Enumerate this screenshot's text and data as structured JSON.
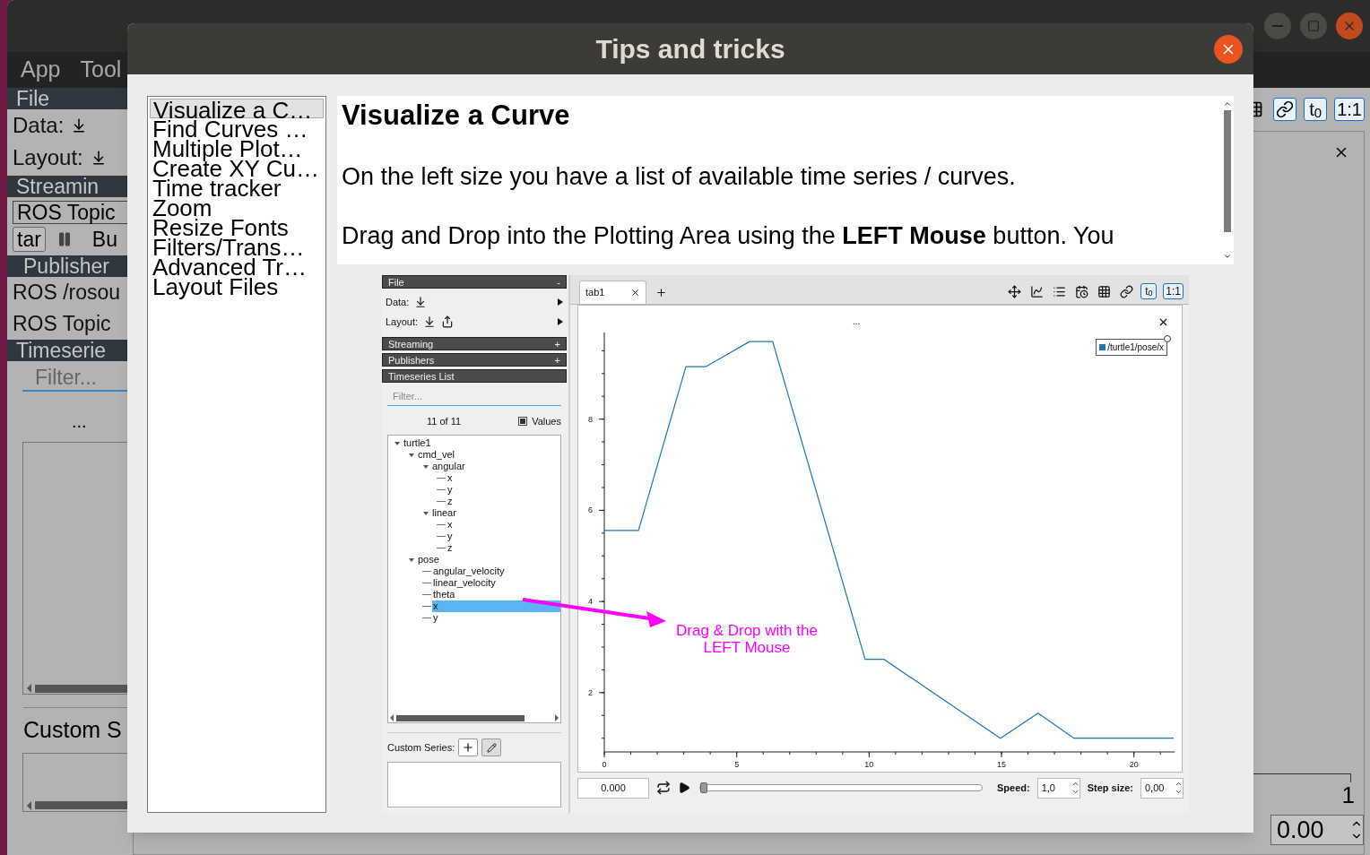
{
  "background_window": {
    "menu": [
      "App",
      "Tool"
    ],
    "sidebar": {
      "file_header": "File",
      "data_label": "Data:",
      "layout_label": "Layout:",
      "streaming_header": "Streamin",
      "source": "ROS Topic",
      "start_button": "tar",
      "buffer_label": "Bu",
      "publishers_header": "Publisher",
      "publishers": [
        "ROS /rosou",
        "ROS Topic"
      ],
      "timeseries_header": "Timeserie",
      "filter": {
        "placeholder": "Filter..."
      },
      "count": "...",
      "custom_series_label": "Custom S"
    },
    "toolbar": [
      {
        "kind": "grid",
        "on": false
      },
      {
        "kind": "link",
        "on": true
      },
      {
        "kind": "text",
        "label": "t$_{0}$",
        "on": true
      },
      {
        "kind": "text",
        "label": "1:1",
        "on": true
      }
    ],
    "axis_label": "1",
    "step_size": "0.00"
  },
  "dialog": {
    "title": "Tips and tricks",
    "topics": [
      {
        "label": "Visualize a C…",
        "selected": true
      },
      {
        "label": "Find Curves …",
        "selected": false
      },
      {
        "label": "Multiple Plot…",
        "selected": false
      },
      {
        "label": "Create XY Cu…",
        "selected": false
      },
      {
        "label": "Time tracker",
        "selected": false
      },
      {
        "label": "Zoom",
        "selected": false
      },
      {
        "label": "Resize Fonts",
        "selected": false
      },
      {
        "label": "Filters/Trans…",
        "selected": false
      },
      {
        "label": "Advanced Tr…",
        "selected": false
      },
      {
        "label": "Layout Files",
        "selected": false
      }
    ],
    "heading": "Visualize a Curve",
    "paragraphs": [
      "On the left size you have a list of available time series / curves.",
      "Drag and Drop into the Plotting Area using the **LEFT Mouse** button. You"
    ],
    "screenshot": {
      "sidebar": {
        "file_header": "File",
        "file_sign": "-",
        "data_label": "Data:",
        "layout_label": "Layout:",
        "streaming_header": "Streaming",
        "streaming_sign": "+",
        "publishers_header": "Publishers",
        "publishers_sign": "+",
        "timeseries_header": "Timeseries List",
        "filter": {
          "placeholder": "Filter..."
        },
        "count": "11 of 11",
        "values": {
          "label": "Values",
          "checked": true
        },
        "tree": [
          {
            "label": "turtle1",
            "expanded": true,
            "selected": false,
            "children": [
              {
                "label": "cmd_vel",
                "expanded": true,
                "selected": false,
                "children": [
                  {
                    "label": "angular",
                    "expanded": true,
                    "selected": false,
                    "children": [
                      {
                        "label": "x",
                        "selected": false
                      },
                      {
                        "label": "y",
                        "selected": false
                      },
                      {
                        "label": "z",
                        "selected": false
                      }
                    ]
                  },
                  {
                    "label": "linear",
                    "expanded": true,
                    "selected": false,
                    "children": [
                      {
                        "label": "x",
                        "selected": false
                      },
                      {
                        "label": "y",
                        "selected": false
                      },
                      {
                        "label": "z",
                        "selected": false
                      }
                    ]
                  }
                ]
              },
              {
                "label": "pose",
                "expanded": true,
                "selected": false,
                "children": [
                  {
                    "label": "angular_velocity",
                    "selected": false
                  },
                  {
                    "label": "linear_velocity",
                    "selected": false
                  },
                  {
                    "label": "theta",
                    "selected": false
                  },
                  {
                    "label": "x",
                    "selected": true
                  },
                  {
                    "label": "y",
                    "selected": false
                  }
                ]
              }
            ]
          }
        ],
        "custom_series_label": "Custom Series:"
      },
      "tabs": [
        {
          "label": "tab1",
          "selected": true
        }
      ],
      "toolbar": [
        {
          "kind": "move",
          "on": false
        },
        {
          "kind": "cursor",
          "on": false
        },
        {
          "kind": "legend",
          "on": false
        },
        {
          "kind": "calendar",
          "on": false
        },
        {
          "kind": "grid",
          "on": false
        },
        {
          "kind": "link",
          "on": false
        },
        {
          "kind": "text",
          "label": "t$_{0}$",
          "on": true
        },
        {
          "kind": "text",
          "label": "1:1",
          "on": true
        }
      ],
      "plot_title": "...",
      "chart_data": {
        "type": "line",
        "x": [
          0,
          1.29,
          3.08,
          3.83,
          5.48,
          6.36,
          9.85,
          10.56,
          14.96,
          16.38,
          17.73,
          21.5
        ],
        "series": [
          {
            "name": "/turtle1/pose/x",
            "color": "#1f77b4",
            "values": [
              5.56,
              5.56,
              9.15,
              9.15,
              9.7,
              9.7,
              2.73,
              2.73,
              1.0,
              1.55,
              1.0,
              1.0
            ]
          }
        ],
        "xlim": [
          0,
          21.5
        ],
        "ylim": [
          0.7,
          9.9
        ],
        "xticks": [
          0,
          5,
          10,
          15,
          20
        ],
        "yticks": [
          2,
          4,
          6,
          8
        ]
      },
      "annotation": "Drag & Drop with the LEFT Mouse",
      "playback": {
        "time": "0.000",
        "level": 0,
        "speed_label": "Speed:",
        "speed": "1,0",
        "step_label": "Step size:",
        "step": "0,00"
      }
    }
  }
}
